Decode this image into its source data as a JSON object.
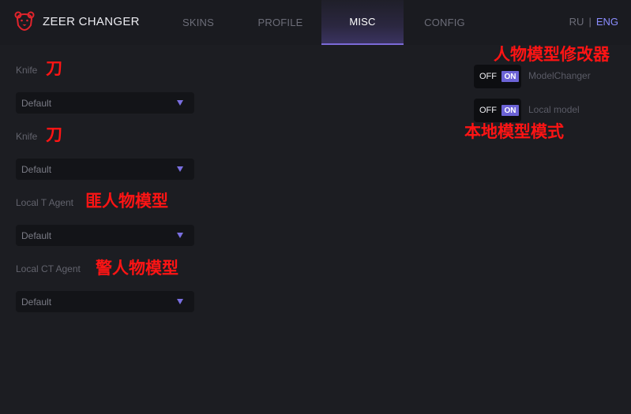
{
  "brand": {
    "name": "ZEER CHANGER",
    "icon": "bear-icon",
    "accent": "#e0242c"
  },
  "tabs": [
    {
      "label": "SKINS",
      "active": false
    },
    {
      "label": "PROFILE",
      "active": false
    },
    {
      "label": "MISC",
      "active": true
    },
    {
      "label": "CONFIG",
      "active": false
    }
  ],
  "language": {
    "ru": "RU",
    "separator": "|",
    "eng": "ENG",
    "selected": "ENG"
  },
  "fields": [
    {
      "label": "Knife",
      "annotation": "刀",
      "value": "Default"
    },
    {
      "label": "Knife",
      "annotation": "刀",
      "value": "Default"
    },
    {
      "label": "Local T Agent",
      "annotation": "匪人物模型",
      "value": "Default"
    },
    {
      "label": "Local CT Agent",
      "annotation": "警人物模型",
      "value": "Default"
    }
  ],
  "toggles": [
    {
      "off": "OFF",
      "on": "ON",
      "state": "on",
      "label": "ModelChanger",
      "annotation": "人物模型修改器"
    },
    {
      "off": "OFF",
      "on": "ON",
      "state": "on",
      "label": "Local model",
      "annotation": "本地模型模式"
    }
  ],
  "colors": {
    "background": "#1c1d22",
    "accent": "#7b6ad8",
    "annotation": "#ff1414"
  }
}
